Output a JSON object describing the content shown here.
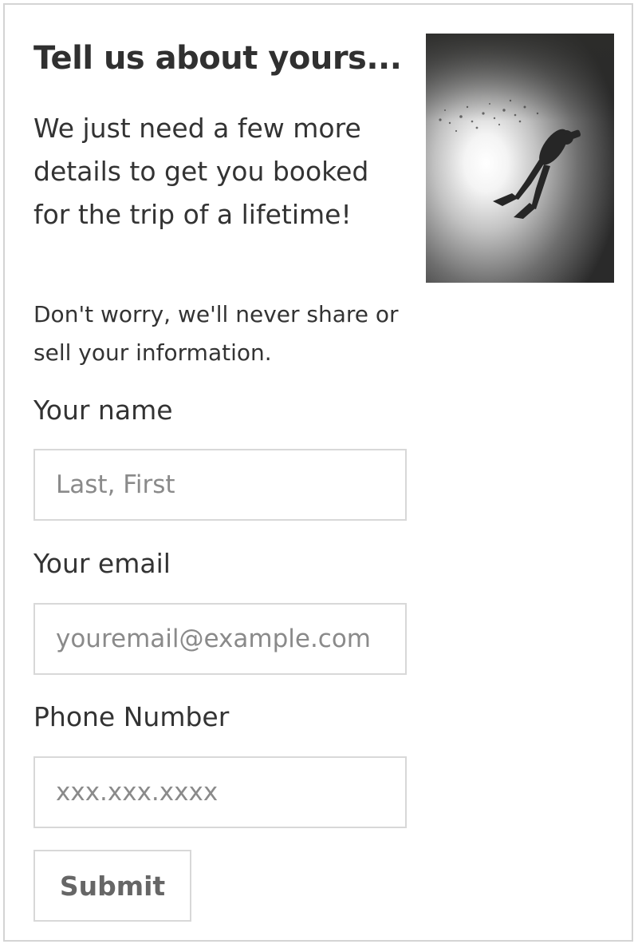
{
  "header": {
    "title": "Tell us about yours..."
  },
  "intro": {
    "text": "We just need a few more details to get you booked for the trip of a lifetime!"
  },
  "privacy": {
    "text": "Don't worry, we'll never share or sell your information."
  },
  "hero_image": {
    "subject": "scuba diver silhouette underwater"
  },
  "form": {
    "name": {
      "label": "Your name",
      "placeholder": "Last, First",
      "value": ""
    },
    "email": {
      "label": "Your email",
      "placeholder": "youremail@example.com",
      "value": ""
    },
    "phone": {
      "label": "Phone Number",
      "placeholder": "xxx.xxx.xxxx",
      "value": ""
    },
    "submit_label": "Submit"
  },
  "colors": {
    "text": "#333333",
    "border": "#d8d8d8",
    "placeholder": "#8a8a8a",
    "button_text": "#666666"
  }
}
